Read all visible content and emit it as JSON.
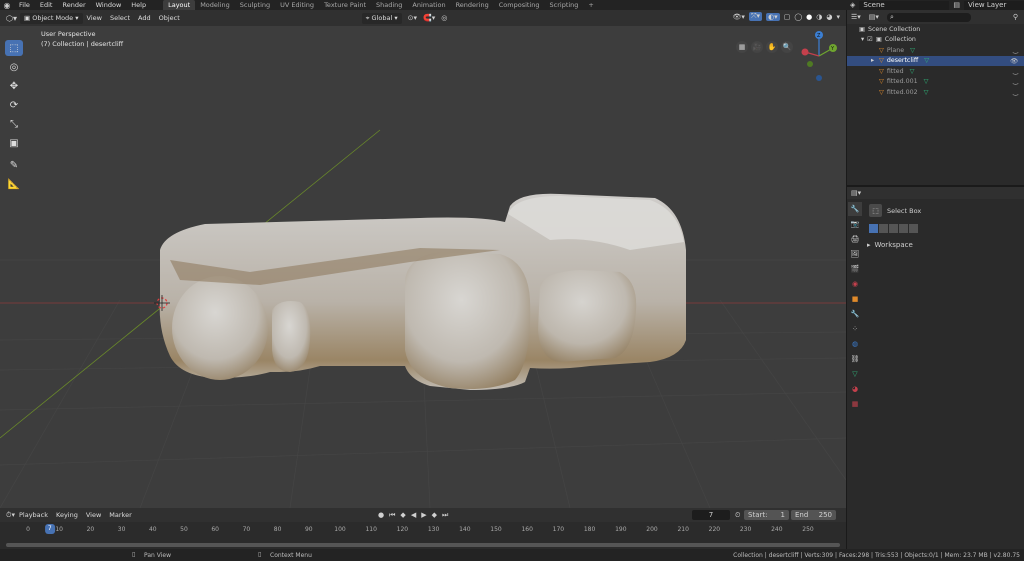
{
  "topbar": {
    "menus": [
      "File",
      "Edit",
      "Render",
      "Window",
      "Help"
    ],
    "workspaces": [
      "Layout",
      "Modeling",
      "Sculpting",
      "UV Editing",
      "Texture Paint",
      "Shading",
      "Animation",
      "Rendering",
      "Compositing",
      "Scripting",
      "+"
    ],
    "active_workspace": "Layout",
    "scene_label": "Scene",
    "view_layer_label": "View Layer"
  },
  "viewport": {
    "mode": "Object Mode",
    "menus": [
      "View",
      "Select",
      "Add",
      "Object"
    ],
    "orientation": "Global",
    "perspective": "User Perspective",
    "collection_info": "(7) Collection | desertcliff",
    "gizmo_axes": [
      "Z",
      "Y",
      "X"
    ]
  },
  "outliner": {
    "root": "Scene Collection",
    "collection": "Collection",
    "items": [
      {
        "name": "Plane",
        "selected": false
      },
      {
        "name": "desertcliff",
        "selected": true
      },
      {
        "name": "fitted",
        "selected": false
      },
      {
        "name": "fitted.001",
        "selected": false
      },
      {
        "name": "fitted.002",
        "selected": false
      }
    ]
  },
  "properties": {
    "tool_name": "Select Box",
    "workspace_label": "Workspace"
  },
  "timeline": {
    "menus": [
      "Playback",
      "Keying",
      "View",
      "Marker"
    ],
    "current_frame": "7",
    "start_label": "Start:",
    "start": "1",
    "end_label": "End",
    "end": "250",
    "ticks": [
      "0",
      "10",
      "20",
      "30",
      "40",
      "50",
      "60",
      "70",
      "80",
      "90",
      "100",
      "110",
      "120",
      "130",
      "140",
      "150",
      "160",
      "170",
      "180",
      "190",
      "200",
      "210",
      "220",
      "230",
      "240",
      "250"
    ]
  },
  "statusbar": {
    "left_hint": "Pan View",
    "right_hint": "Context Menu",
    "stats": "Collection | desertcliff | Verts:309 | Faces:298 | Tris:553 | Objects:0/1 | Mem: 23.7 MB | v2.80.75"
  },
  "colors": {
    "accent": "#4772b3",
    "selected_row": "#334d80",
    "x_axis": "#c4404c",
    "y_axis": "#6fa52f",
    "z_axis": "#3b7fd4"
  }
}
